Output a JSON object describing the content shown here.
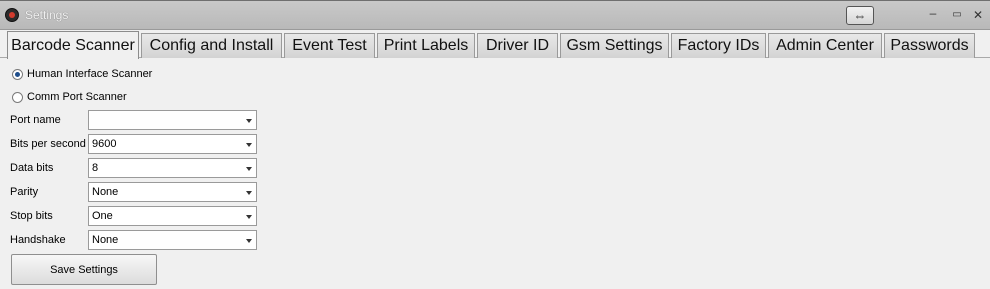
{
  "window": {
    "title": "Settings",
    "icon": "app-logo-icon",
    "controls": {
      "resize_glyph": "⇔",
      "minimize": "–",
      "maximize": "▭",
      "close": "✕"
    }
  },
  "tabs": [
    {
      "label": "Barcode Scanner",
      "active": true
    },
    {
      "label": "Config and Install",
      "active": false
    },
    {
      "label": "Event Test",
      "active": false
    },
    {
      "label": "Print Labels",
      "active": false
    },
    {
      "label": "Driver ID",
      "active": false
    },
    {
      "label": "Gsm Settings",
      "active": false
    },
    {
      "label": "Factory IDs",
      "active": false
    },
    {
      "label": "Admin Center",
      "active": false
    },
    {
      "label": "Passwords",
      "active": false
    }
  ],
  "scanner_mode": {
    "options": [
      {
        "label": "Human Interface Scanner",
        "checked": true
      },
      {
        "label": "Comm Port Scanner",
        "checked": false
      }
    ]
  },
  "fields": [
    {
      "label": "Port name",
      "value": ""
    },
    {
      "label": "Bits per second",
      "value": "9600"
    },
    {
      "label": "Data bits",
      "value": "8"
    },
    {
      "label": "Parity",
      "value": "None"
    },
    {
      "label": "Stop bits",
      "value": "One"
    },
    {
      "label": "Handshake",
      "value": "None"
    }
  ],
  "save_button": {
    "label": "Save Settings"
  }
}
